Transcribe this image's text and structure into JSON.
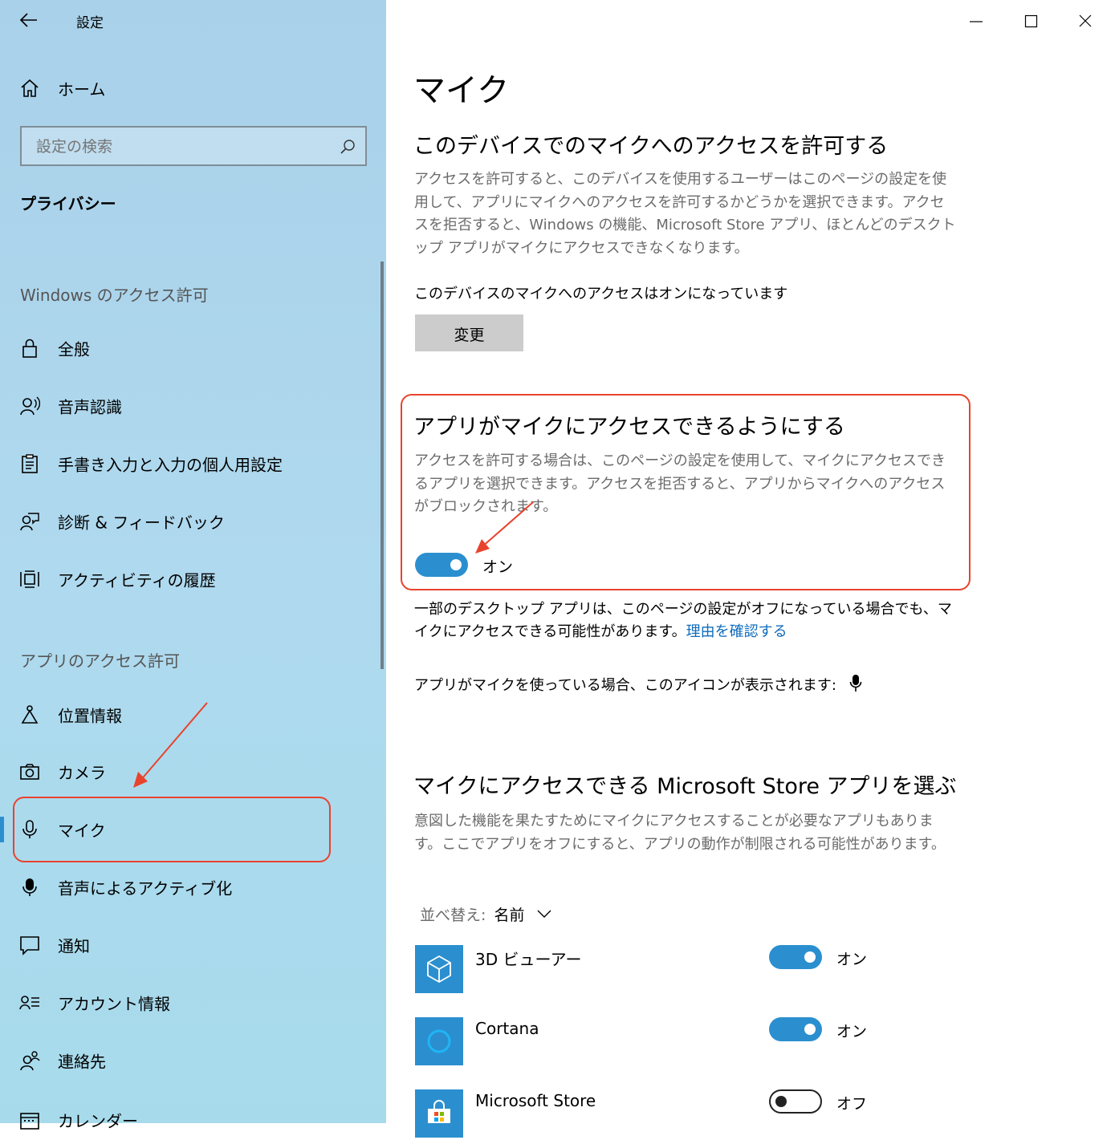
{
  "window": {
    "title": "設定",
    "controls": [
      "minimize",
      "maximize",
      "close"
    ]
  },
  "sidebar": {
    "home_label": "ホーム",
    "search_placeholder": "設定の検索",
    "category": "プライバシー",
    "windows_section_title": "Windows のアクセス許可",
    "windows_items": [
      {
        "label": "全般",
        "icon": "lock-icon"
      },
      {
        "label": "音声認識",
        "icon": "speech-icon"
      },
      {
        "label": "手書き入力と入力の個人用設定",
        "icon": "clipboard-icon"
      },
      {
        "label": "診断 & フィードバック",
        "icon": "feedback-icon"
      },
      {
        "label": "アクティビティの履歴",
        "icon": "timeline-icon"
      }
    ],
    "apps_section_title": "アプリのアクセス許可",
    "app_items": [
      {
        "label": "位置情報",
        "icon": "location-icon"
      },
      {
        "label": "カメラ",
        "icon": "camera-icon"
      },
      {
        "label": "マイク",
        "icon": "microphone-icon",
        "selected": true
      },
      {
        "label": "音声によるアクティブ化",
        "icon": "voice-activation-icon"
      },
      {
        "label": "通知",
        "icon": "notification-icon"
      },
      {
        "label": "アカウント情報",
        "icon": "account-info-icon"
      },
      {
        "label": "連絡先",
        "icon": "contacts-icon"
      },
      {
        "label": "カレンダー",
        "icon": "calendar-icon"
      }
    ]
  },
  "main": {
    "page_title": "マイク",
    "device_section": {
      "heading": "このデバイスでのマイクへのアクセスを許可する",
      "description": "アクセスを許可すると、このデバイスを使用するユーザーはこのページの設定を使用して、アプリにマイクへのアクセスを許可するかどうかを選択できます。アクセスを拒否すると、Windows の機能、Microsoft Store アプリ、ほとんどのデスクトップ アプリがマイクにアクセスできなくなります。",
      "status": "このデバイスのマイクへのアクセスはオンになっています",
      "change_button": "変更"
    },
    "apps_section": {
      "heading": "アプリがマイクにアクセスできるようにする",
      "description": "アクセスを許可する場合は、このページの設定を使用して、マイクにアクセスできるアプリを選択できます。アクセスを拒否すると、アプリからマイクへのアクセスがブロックされます。",
      "toggle_label": "オン",
      "toggle_on": true,
      "note": "一部のデスクトップ アプリは、このページの設定がオフになっている場合でも、マイクにアクセスできる可能性があります。",
      "note_link": "理由を確認する",
      "icon_note": "アプリがマイクを使っている場合、このアイコンが表示されます:"
    },
    "store_section": {
      "heading": "マイクにアクセスできる Microsoft Store アプリを選ぶ",
      "description": "意図した機能を果たすためにマイクにアクセスすることが必要なアプリもあります。ここでアプリをオフにすると、アプリの動作が制限される可能性があります。",
      "sort_label": "並べ替え:",
      "sort_value": "名前",
      "apps": [
        {
          "name": "3D ビューアー",
          "state": "オン",
          "on": true,
          "icon": "cube-icon"
        },
        {
          "name": "Cortana",
          "state": "オン",
          "on": true,
          "icon": "cortana-icon"
        },
        {
          "name": "Microsoft Store",
          "state": "オフ",
          "on": false,
          "icon": "store-bag-icon"
        }
      ]
    }
  },
  "colors": {
    "sidebar_bg": "#a9d5ec",
    "accent": "#2b8fcf",
    "annotation_red": "#e8432d",
    "button_bg": "#cccccc"
  }
}
